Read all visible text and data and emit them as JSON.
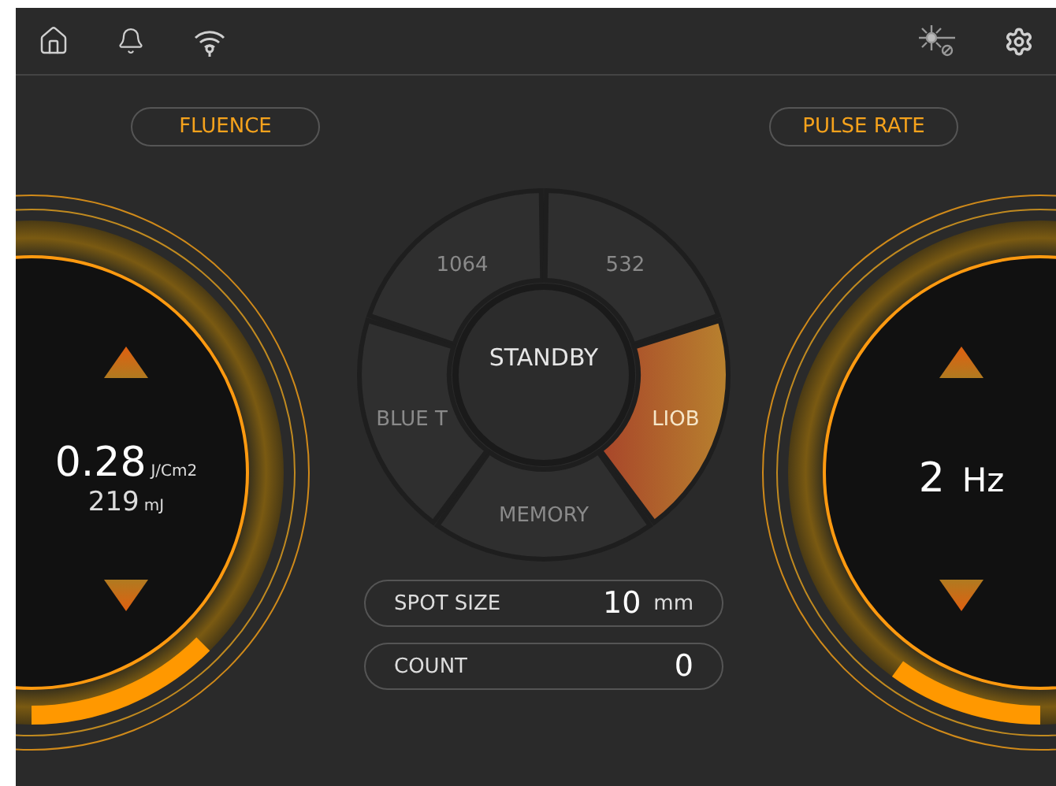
{
  "top_bar": {
    "status_icon_active": false
  },
  "fluence": {
    "label": "FLUENCE",
    "value": "0.28",
    "unit": "J/Cm2",
    "energy": "219",
    "energy_unit": "mJ",
    "level": 0.125
  },
  "pulse_rate": {
    "label": "PULSE RATE",
    "value": "2",
    "unit": "Hz",
    "level": 0.1
  },
  "modes": [
    {
      "label": "1064",
      "selected": false
    },
    {
      "label": "532",
      "selected": false
    },
    {
      "label": "LIOB",
      "selected": true
    },
    {
      "label": "MEMORY",
      "selected": false
    },
    {
      "label": "BLUE T",
      "selected": false
    }
  ],
  "center_button": "STANDBY",
  "readouts": [
    {
      "label": "SPOT SIZE",
      "value": "10",
      "unit": "mm"
    },
    {
      "label": "COUNT",
      "value": "0"
    }
  ]
}
